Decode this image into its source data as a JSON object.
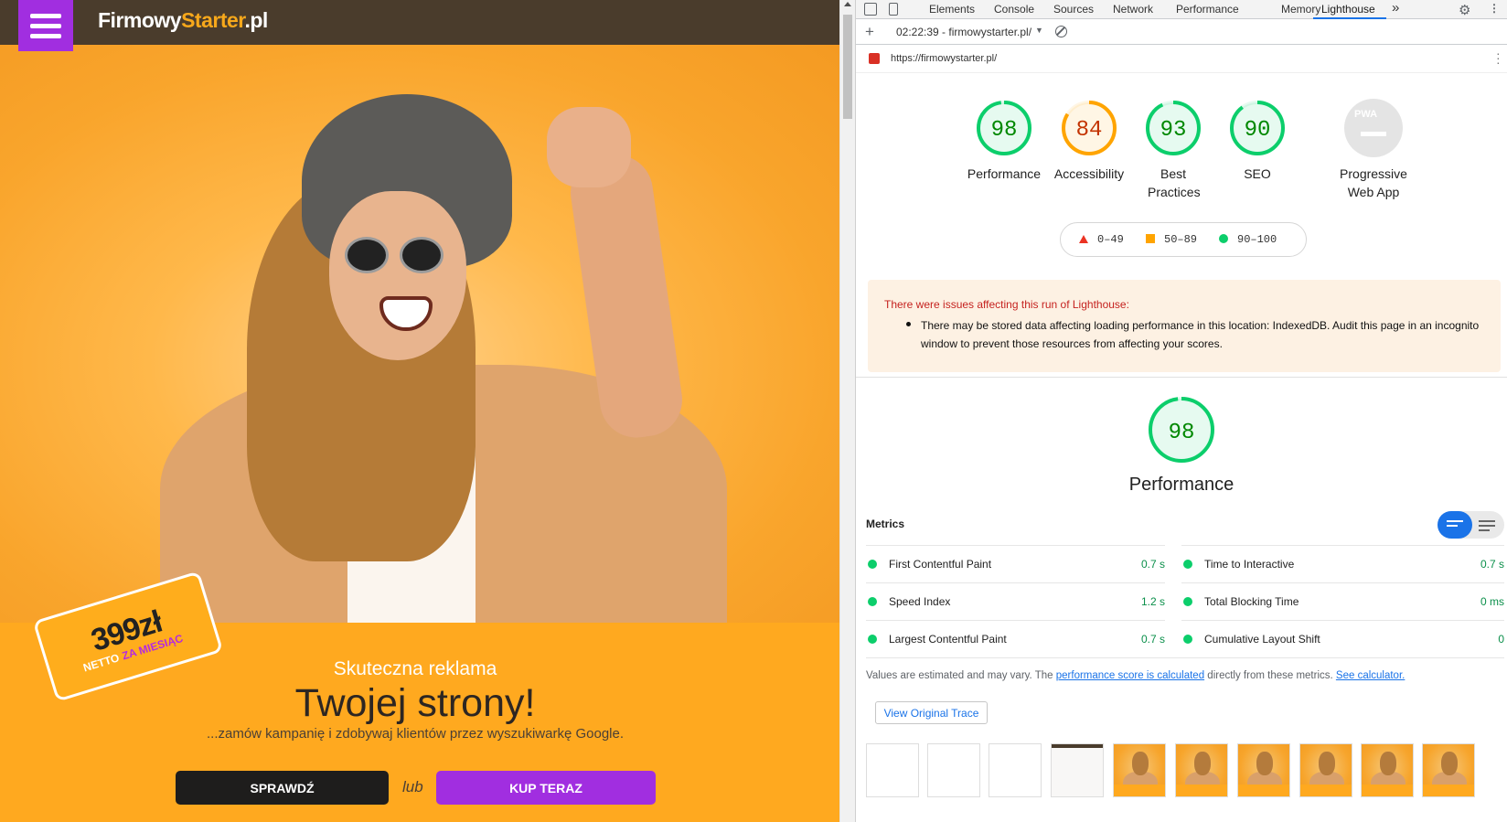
{
  "site": {
    "logo_part1": "Firmowy",
    "logo_part2": "Starter",
    "logo_part3": ".pl",
    "price": "399zł",
    "price_netto": "NETTO",
    "price_period": "ZA MIESIĄC",
    "tagline_small": "Skuteczna reklama",
    "tagline_big": "Twojej strony!",
    "tagline_sub": "...zamów kampanię i zdobywaj klientów przez wyszukiwarkę Google.",
    "btn_check": "SPRAWDŹ",
    "or_text": "lub",
    "btn_buy": "KUP TERAZ",
    "colors": {
      "brand_purple": "#a12ee0",
      "header_brown": "#4a3c2c",
      "orange": "#ffa91f"
    }
  },
  "devtools": {
    "tabs": [
      "Elements",
      "Console",
      "Sources",
      "Network",
      "Performance",
      "Memory",
      "Lighthouse"
    ],
    "active_tab": "Lighthouse",
    "more_tabs": "»",
    "run_label": "02:22:39 - firmowystarter.pl/",
    "url": "https://firmowystarter.pl/",
    "icons": [
      "inspect-icon",
      "device-toggle-icon",
      "settings-gear-icon",
      "more-kebab-icon",
      "add-icon",
      "clear-icon",
      "lock-icon"
    ]
  },
  "lighthouse": {
    "categories": [
      {
        "label": "Performance",
        "score": 98,
        "color": "#0cce6b"
      },
      {
        "label": "Accessibility",
        "score": 84,
        "color": "#ffa400"
      },
      {
        "label": "Best Practices",
        "score": 93,
        "color": "#0cce6b"
      },
      {
        "label": "SEO",
        "score": 90,
        "color": "#0cce6b"
      }
    ],
    "pwa_label": "Progressive Web App",
    "pwa_badge": "PWA",
    "legend": {
      "fail": "0–49",
      "average": "50–89",
      "pass": "90–100"
    },
    "warning_title": "There were issues affecting this run of Lighthouse:",
    "warning_text": "There may be stored data affecting loading performance in this location: IndexedDB. Audit this page in an incognito window to prevent those resources from affecting your scores.",
    "perf_score": 98,
    "perf_title": "Performance",
    "metrics_heading": "Metrics",
    "metrics": [
      {
        "name": "First Contentful Paint",
        "value": "0.7 s"
      },
      {
        "name": "Time to Interactive",
        "value": "0.7 s"
      },
      {
        "name": "Speed Index",
        "value": "1.2 s"
      },
      {
        "name": "Total Blocking Time",
        "value": "0 ms"
      },
      {
        "name": "Largest Contentful Paint",
        "value": "0.7 s"
      },
      {
        "name": "Cumulative Layout Shift",
        "value": "0"
      }
    ],
    "note_prefix": "Values are estimated and may vary. The ",
    "note_link1": "performance score is calculated",
    "note_middle": " directly from these metrics. ",
    "note_link2": "See calculator.",
    "view_trace": "View Original Trace"
  }
}
